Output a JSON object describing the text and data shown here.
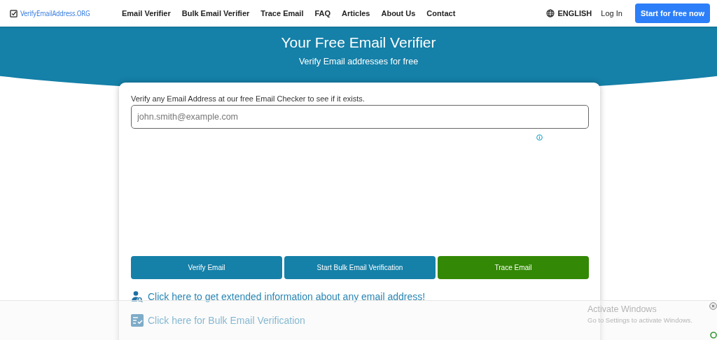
{
  "header": {
    "logo": "VerifyEmailAddress.ORG",
    "nav": [
      "Email Verifier",
      "Bulk Email Verifier",
      "Trace Email",
      "FAQ",
      "Articles",
      "About Us",
      "Contact"
    ],
    "language": "ENGLISH",
    "login": "Log In",
    "cta": "Start for free now"
  },
  "hero": {
    "title": "Your Free Email Verifier",
    "subtitle": "Verify Email addresses for free"
  },
  "card": {
    "intro": "Verify any Email Address at our free Email Checker to see if it exists.",
    "email_field": {
      "placeholder": "john.smith@example.com"
    },
    "buttons": [
      {
        "label": "Verify Email",
        "kind": "primary"
      },
      {
        "label": "Start Bulk Email Verification",
        "kind": "primary"
      },
      {
        "label": "Trace Email",
        "kind": "success"
      }
    ],
    "links": [
      {
        "label": "Click here to get extended information about any email address!",
        "kind": "person"
      },
      {
        "label": "Click here for Bulk Email Verification",
        "kind": "checklist"
      }
    ]
  },
  "os_notice": {
    "title": "Activate Windows",
    "text": "Go to Settings to activate Windows."
  }
}
